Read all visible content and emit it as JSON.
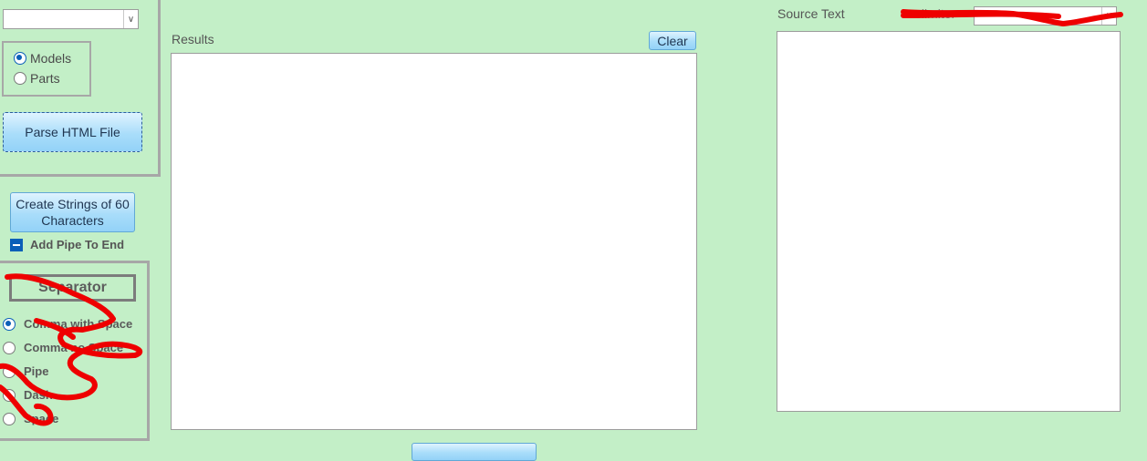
{
  "top_combo": {
    "value": ""
  },
  "mode_options": [
    {
      "label": "Models",
      "selected": true
    },
    {
      "label": "Parts",
      "selected": false
    }
  ],
  "parse_button": {
    "label": "Parse HTML File"
  },
  "create_strings_button": {
    "label": "Create Strings of 60 Characters"
  },
  "add_pipe": {
    "label": "Add Pipe To End",
    "checked": true
  },
  "separator": {
    "title": "Separator",
    "options": [
      {
        "label": "Comma with Space",
        "selected": true
      },
      {
        "label": "Comma no Space",
        "selected": false
      },
      {
        "label": "Pipe",
        "selected": false
      },
      {
        "label": "Dash",
        "selected": false
      },
      {
        "label": "Space",
        "selected": false
      }
    ]
  },
  "results": {
    "label": "Results",
    "value": ""
  },
  "clear_button": {
    "label": "Clear"
  },
  "source_text": {
    "label": "Source Text",
    "value": ""
  },
  "delimiter": {
    "label": "Delimiter",
    "value": ""
  },
  "colors": {
    "background": "#c3efc7",
    "accent": "#0b5fb8",
    "scribble": "#ee0000"
  }
}
